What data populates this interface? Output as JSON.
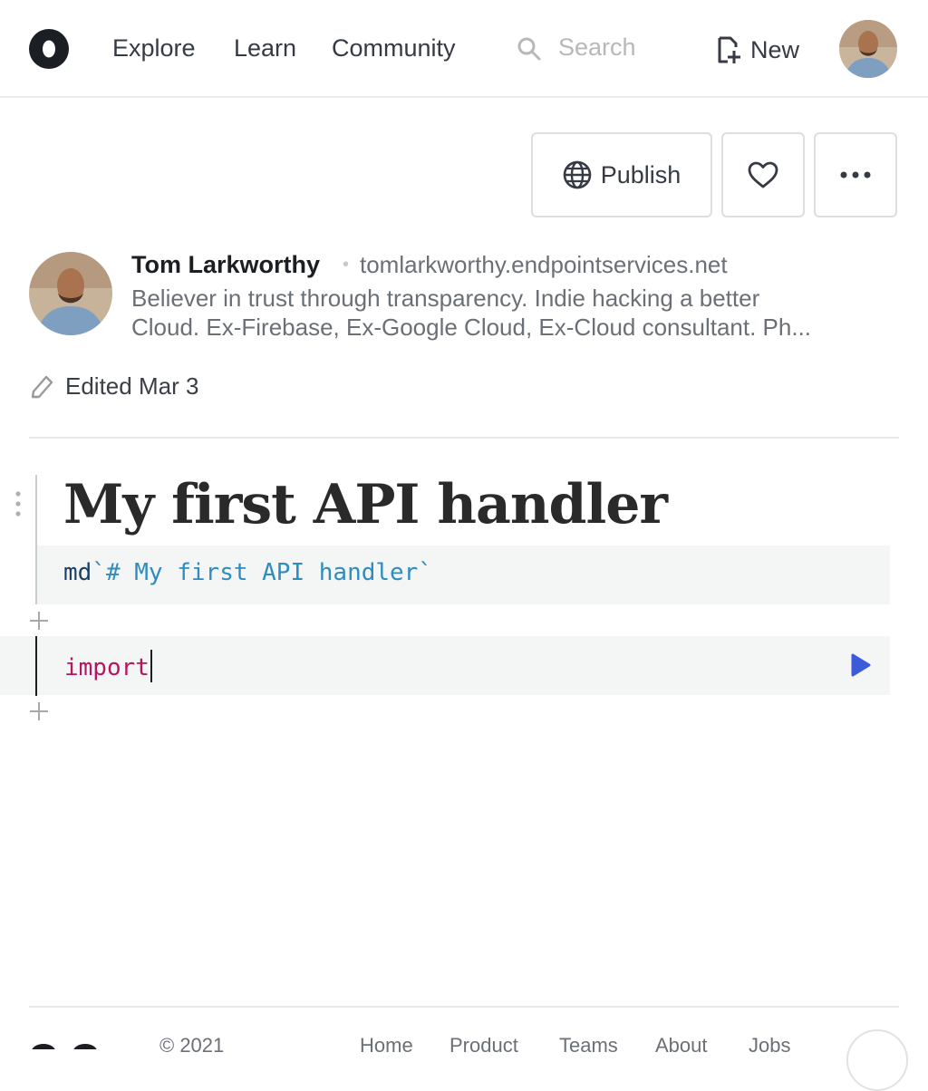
{
  "nav": {
    "links": [
      "Explore",
      "Learn",
      "Community"
    ],
    "search_placeholder": "Search",
    "new_label": "New"
  },
  "toolbar": {
    "publish_label": "Publish"
  },
  "author": {
    "name": "Tom Larkworthy",
    "site": "tomlarkworthy.endpointservices.net",
    "bio_line1": "Believer in trust through transparency. Indie hacking a better",
    "bio_line2": "Cloud. Ex-Firebase, Ex-Google Cloud, Ex-Cloud consultant. Ph..."
  },
  "edited": "Edited Mar 3",
  "cells": {
    "title": "My first API handler",
    "markdown_fn": "md",
    "markdown_src": "`# My first API handler`",
    "code": "import"
  },
  "footer": {
    "copyright": "© 2021",
    "links": [
      "Home",
      "Product",
      "Teams",
      "About",
      "Jobs"
    ]
  },
  "colors": {
    "accent": "#3b5bdb",
    "keyword": "#b5175f",
    "string": "#2f8cbf"
  }
}
